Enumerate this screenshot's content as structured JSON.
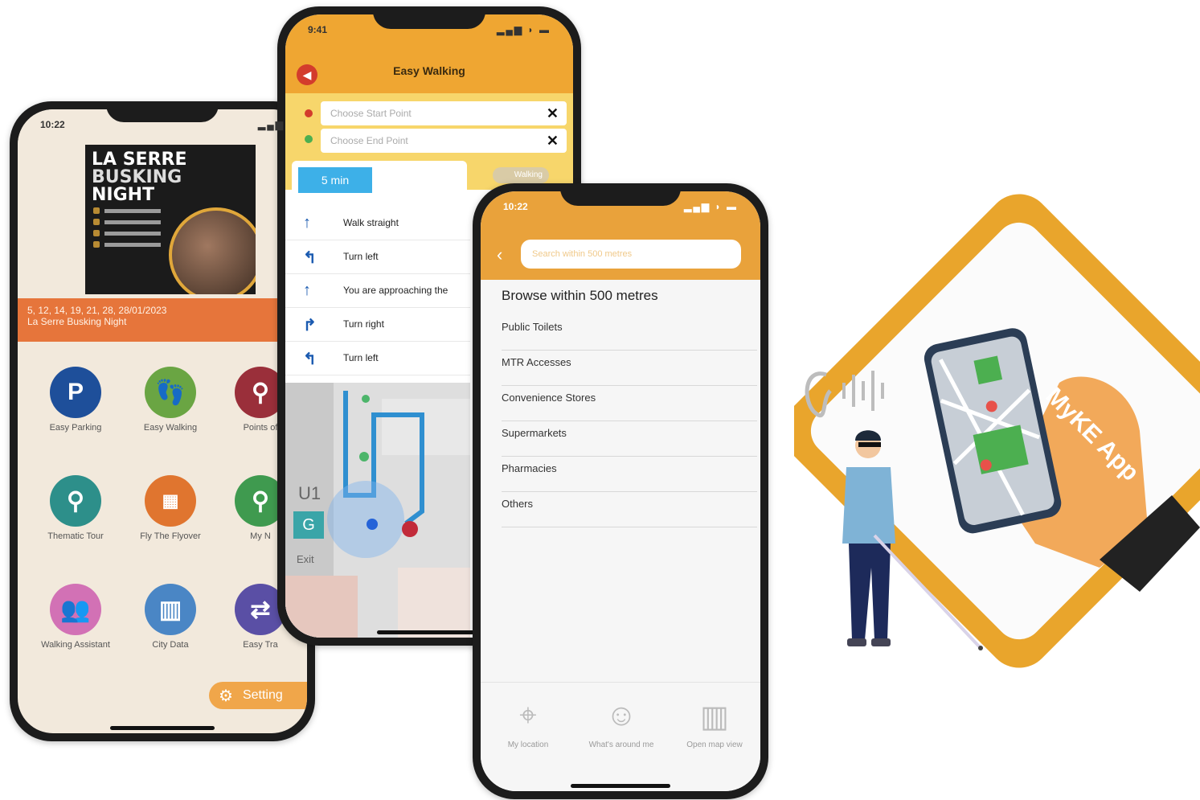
{
  "colors": {
    "accent_orange": "#efa632",
    "banner_orange": "#e6753b",
    "beige_bg": "#f2e9dc",
    "route_yellow": "#f7d66b",
    "time_blue": "#3db0e8",
    "brand_gold": "#e9a52c"
  },
  "phone1": {
    "status_time": "10:22",
    "poster": {
      "title_lines": [
        "LA SERRE",
        "BUSKING",
        "NIGHT"
      ]
    },
    "banner": {
      "dates": "5, 12, 14, 19, 21, 28, 28/01/2023",
      "event": "La Serre Busking Night"
    },
    "tiles": [
      {
        "label": "Easy Parking",
        "icon": "parking-icon",
        "color": "#1e4f9a"
      },
      {
        "label": "Easy Walking",
        "icon": "footsteps-icon",
        "color": "#6aa543"
      },
      {
        "label": "Points of",
        "icon": "map-pin-icon",
        "color": "#9a2f3a"
      },
      {
        "label": "Thematic Tour",
        "icon": "tour-pins-icon",
        "color": "#2d8f8a"
      },
      {
        "label": "Fly The Flyover",
        "icon": "flyover-icon",
        "color": "#e0752f"
      },
      {
        "label": "My N",
        "icon": "location-icon",
        "color": "#3f9a4f"
      },
      {
        "label": "Walking Assistant",
        "icon": "assistant-people-icon",
        "color": "#d271b5"
      },
      {
        "label": "City Data",
        "icon": "city-data-icon",
        "color": "#4a86c5"
      },
      {
        "label": "Easy Tra",
        "icon": "transport-icon",
        "color": "#5a4fa5"
      }
    ],
    "setting_label": "Setting"
  },
  "phone2": {
    "status_time": "9:41",
    "title": "Easy Walking",
    "start_placeholder": "Choose Start Point",
    "end_placeholder": "Choose End Point",
    "duration": "5 min",
    "mode_label": "Walking",
    "directions": [
      {
        "arrow": "↑",
        "text": "Walk straight"
      },
      {
        "arrow": "↰",
        "text": "Turn left"
      },
      {
        "arrow": "↑",
        "text": "You are approaching the"
      },
      {
        "arrow": "↱",
        "text": "Turn right"
      },
      {
        "arrow": "↰",
        "text": "Turn left"
      }
    ],
    "map": {
      "floor_u1": "U1",
      "floor_g": "G",
      "exit_label": "Exit"
    }
  },
  "phone3": {
    "status_time": "10:22",
    "search_placeholder": "Search within 500 metres",
    "heading": "Browse within 500 metres",
    "items": [
      "Public Toilets",
      "MTR Accesses",
      "Convenience Stores",
      "Supermarkets",
      "Pharmacies",
      "Others"
    ],
    "nav": [
      {
        "label": "My location",
        "icon": "crosshair-icon"
      },
      {
        "label": "What's around me",
        "icon": "person-pin-icon"
      },
      {
        "label": "Open map view",
        "icon": "folded-map-icon"
      }
    ]
  },
  "promo": {
    "brand": "MyKE App"
  }
}
